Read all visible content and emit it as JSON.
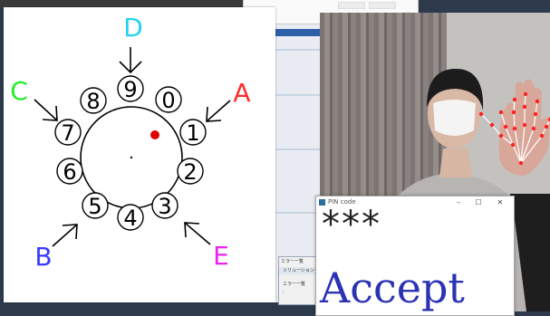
{
  "dial": {
    "center_dot_color": "#111111",
    "marker_color": "#e00000",
    "digits": [
      {
        "label": "0"
      },
      {
        "label": "1"
      },
      {
        "label": "2"
      },
      {
        "label": "3"
      },
      {
        "label": "4"
      },
      {
        "label": "5"
      },
      {
        "label": "6"
      },
      {
        "label": "7"
      },
      {
        "label": "8"
      },
      {
        "label": "9"
      }
    ],
    "gestures": [
      {
        "label": "A",
        "color": "#ff2a2a"
      },
      {
        "label": "B",
        "color": "#3a3aff"
      },
      {
        "label": "C",
        "color": "#22ee22"
      },
      {
        "label": "D",
        "color": "#22d4ee"
      },
      {
        "label": "E",
        "color": "#ee22ee"
      }
    ]
  },
  "top_popup": {
    "glyph_left": "⁘",
    "glyph_right": "⁙"
  },
  "error_list": {
    "title": "エラー一覧",
    "toolbar_label": "ソリューション",
    "row1": "エラー一覧",
    "row2": ":"
  },
  "pin_window": {
    "title": "PIN code",
    "minimize": "–",
    "maximize": "☐",
    "close": "✕",
    "masked_pin": "***",
    "status_text": "Accept"
  },
  "camera": {
    "landmark_color": "#ff2020",
    "skeleton_color": "#ffffff"
  }
}
